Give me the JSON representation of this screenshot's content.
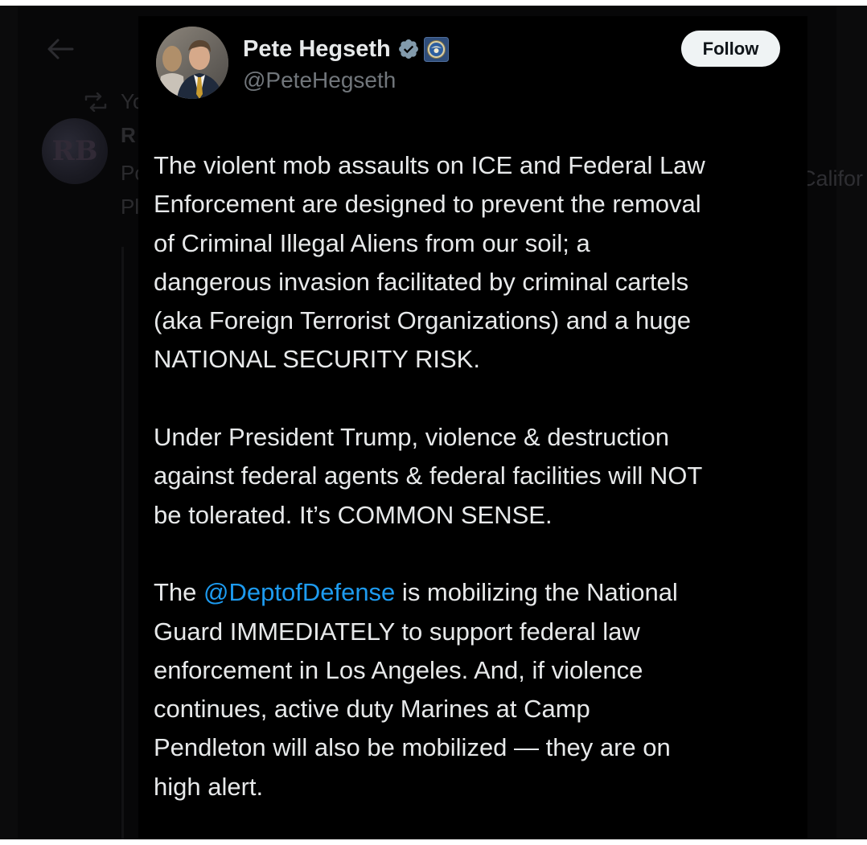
{
  "background": {
    "ghost_repost_text": "Yo",
    "ghost_name": "R",
    "ghost_avatar_monogram": "RB",
    "ghost_line_1": "Po",
    "ghost_line_2": "Pl",
    "ghost_side_text": "Califor"
  },
  "tweet": {
    "display_name": "Pete Hegseth",
    "handle": "@PeteHegseth",
    "follow_label": "Follow",
    "paragraph_1": [
      "The violent mob assaults on ICE and Federal Law",
      "Enforcement are designed to prevent the removal",
      "of Criminal Illegal Aliens from our soil; a",
      "dangerous invasion facilitated by criminal cartels",
      "(aka Foreign Terrorist Organizations) and a huge",
      "NATIONAL SECURITY RISK."
    ],
    "paragraph_2": [
      "Under President Trump, violence & destruction",
      "against federal agents & federal facilities will NOT",
      "be tolerated. It’s COMMON SENSE."
    ],
    "paragraph_3": {
      "line_1_before": "The ",
      "mention": "@DeptofDefense",
      "line_1_after": " is mobilizing the National",
      "lines": [
        "Guard IMMEDIATELY to support federal law",
        "enforcement in Los Angeles. And, if violence",
        "continues, active duty Marines at Camp",
        "Pendleton will also be mobilized — they are on",
        "high alert."
      ]
    }
  },
  "colors": {
    "text_primary": "#e7e9ea",
    "text_secondary": "#71767b",
    "link": "#1d9bf0",
    "verified": "#829aab",
    "follow_bg": "#eff3f4",
    "card_bg": "#000000"
  },
  "icons": {
    "back": "arrow-left-icon",
    "repost": "repost-icon",
    "verified": "verified-badge-icon",
    "affiliation": "dod-seal-icon"
  }
}
